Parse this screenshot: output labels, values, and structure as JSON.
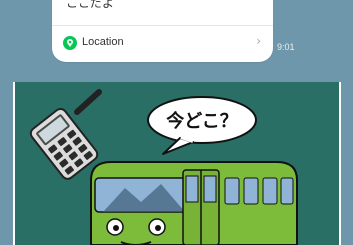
{
  "message": {
    "text_partial": "ここだよ",
    "location_label": "Location",
    "chevron": "›",
    "time": "9:01"
  },
  "image": {
    "speech_bubble_text": "今どこ？",
    "icons": {
      "location": "location-pin-icon",
      "walkie_talkie": "walkie-talkie-icon",
      "train": "train-icon"
    }
  },
  "colors": {
    "chat_background": "#6f97ab",
    "image_background": "#2a6f66",
    "location_icon": "#06c755",
    "train_body": "#7dbb3a"
  }
}
